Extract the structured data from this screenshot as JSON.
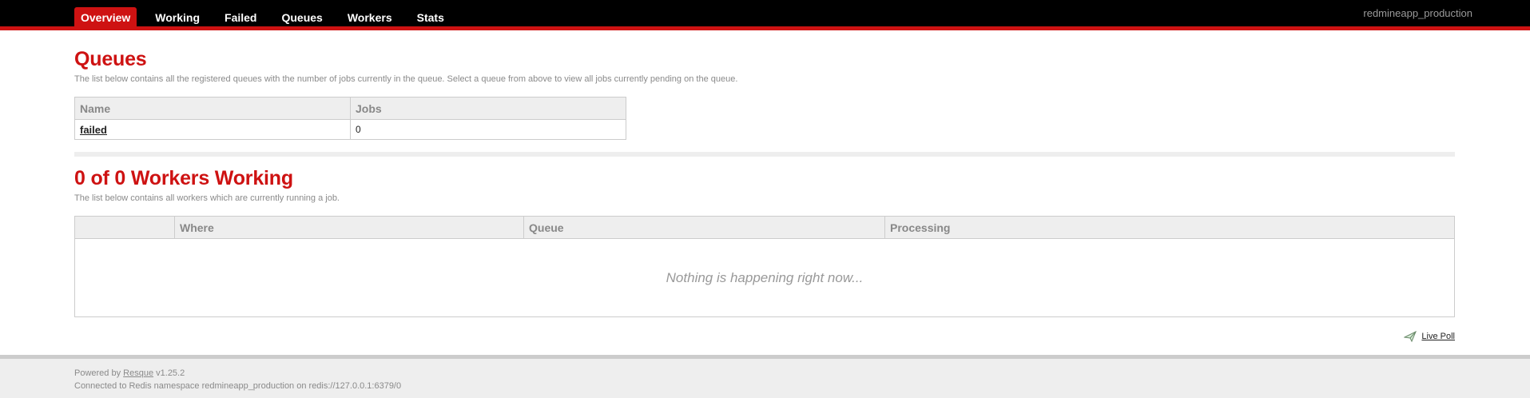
{
  "header": {
    "tabs": [
      {
        "label": "Overview",
        "active": true
      },
      {
        "label": "Working",
        "active": false
      },
      {
        "label": "Failed",
        "active": false
      },
      {
        "label": "Queues",
        "active": false
      },
      {
        "label": "Workers",
        "active": false
      },
      {
        "label": "Stats",
        "active": false
      }
    ],
    "namespace": "redmineapp_production"
  },
  "queues": {
    "title": "Queues",
    "description": "The list below contains all the registered queues with the number of jobs currently in the queue. Select a queue from above to view all jobs currently pending on the queue.",
    "columns": [
      "Name",
      "Jobs"
    ],
    "rows": [
      {
        "name": "failed",
        "jobs": "0"
      }
    ]
  },
  "workers": {
    "title": "0 of 0 Workers Working",
    "description": "The list below contains all workers which are currently running a job.",
    "columns": [
      "",
      "Where",
      "Queue",
      "Processing"
    ],
    "empty_message": "Nothing is happening right now..."
  },
  "poll": {
    "label": "Live Poll",
    "icon": "poll-icon"
  },
  "footer": {
    "powered_prefix": "Powered by",
    "powered_link": "Resque",
    "version": "v1.25.2",
    "connection": "Connected to Redis namespace redmineapp_production on redis://127.0.0.1:6379/0"
  },
  "colors": {
    "accent": "#ce1212",
    "header_bg": "#000000",
    "footer_bg": "#eeeeee"
  }
}
